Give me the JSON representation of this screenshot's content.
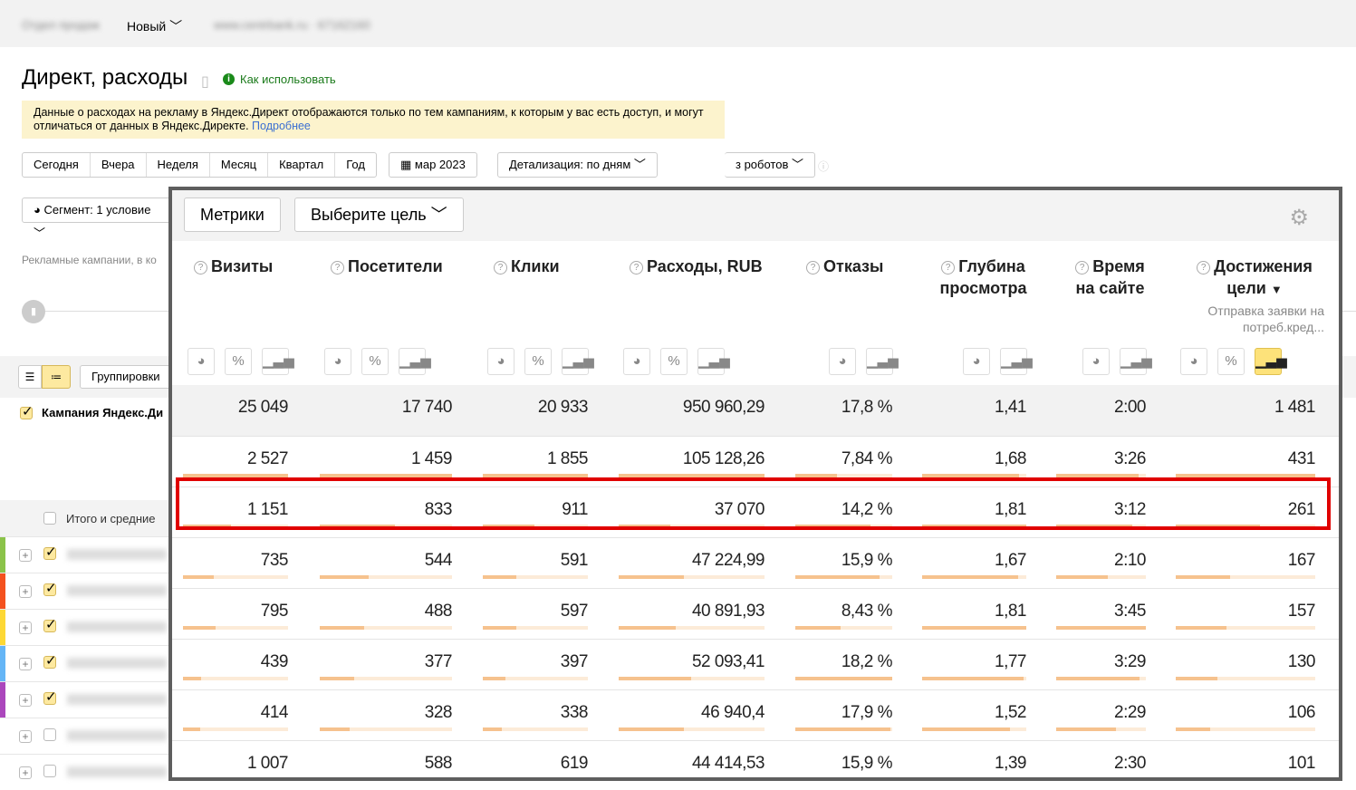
{
  "topbar": {
    "counter_name": "Отдел продаж",
    "counter_type": "Новый",
    "site": "www.centrbank.ru · 67162160"
  },
  "page": {
    "title": "Директ, расходы",
    "how_to": "Как использовать"
  },
  "notice": {
    "text": "Данные о расходах на рекламу в Яндекс.Директ отображаются только по тем кампаниям, к которым у вас есть доступ, и могут отличаться от данных в Яндекс.Директе.",
    "link": "Подробнее"
  },
  "periods": [
    "Сегодня",
    "Вчера",
    "Неделя",
    "Месяц",
    "Квартал",
    "Год"
  ],
  "date_range": "мар 2023",
  "detail": "Детализация: по дням",
  "robots": "з роботов",
  "segment": "Сегмент: 1 условие",
  "campaigns_label": "Рекламные кампании, в ко",
  "groupings": "Группировки",
  "grouping_root": "Кампания Яндекс.Ди",
  "totals_label": "Итого и средние",
  "left_rows": [
    {
      "color": "#8bc34a",
      "checked": true
    },
    {
      "color": "#f4511e",
      "checked": true
    },
    {
      "color": "#fdd835",
      "checked": true
    },
    {
      "color": "#64b5f6",
      "checked": true
    },
    {
      "color": "#ab47bc",
      "checked": true
    },
    {
      "color": "",
      "checked": false
    },
    {
      "color": "",
      "checked": false
    }
  ],
  "panel": {
    "metrics_button": "Метрики",
    "goal_button": "Выберите цель",
    "columns": [
      {
        "label": "Визиты",
        "icons": [
          "pie",
          "percent",
          "bars"
        ]
      },
      {
        "label": "Посетители",
        "icons": [
          "pie",
          "percent",
          "bars"
        ]
      },
      {
        "label": "Клики",
        "icons": [
          "pie",
          "percent",
          "bars"
        ]
      },
      {
        "label": "Расходы, RUB",
        "icons": [
          "pie",
          "percent",
          "bars"
        ]
      },
      {
        "label": "Отказы",
        "icons": [
          "pie",
          "bars"
        ]
      },
      {
        "label": "Глубина просмотра",
        "icons": [
          "pie",
          "bars"
        ]
      },
      {
        "label": "Время на сайте",
        "icons": [
          "pie",
          "bars"
        ]
      },
      {
        "label": "Достижения цели",
        "sort": "▼",
        "sub": "Отправка заявки на потреб.кред...",
        "icons": [
          "pie",
          "percent",
          "bars"
        ],
        "active_icon": "bars"
      }
    ],
    "totals": [
      "25 049",
      "17 740",
      "20 933",
      "950 960,29",
      "17,8 %",
      "1,41",
      "2:00",
      "1 481"
    ],
    "rows": [
      [
        "2 527",
        "1 459",
        "1 855",
        "105 128,26",
        "7,84 %",
        "1,68",
        "3:26",
        "431"
      ],
      [
        "1 151",
        "833",
        "911",
        "37 070",
        "14,2 %",
        "1,81",
        "3:12",
        "261"
      ],
      [
        "735",
        "544",
        "591",
        "47 224,99",
        "15,9 %",
        "1,67",
        "2:10",
        "167"
      ],
      [
        "795",
        "488",
        "597",
        "40 891,93",
        "8,43 %",
        "1,81",
        "3:45",
        "157"
      ],
      [
        "439",
        "377",
        "397",
        "52 093,41",
        "18,2 %",
        "1,77",
        "3:29",
        "130"
      ],
      [
        "414",
        "328",
        "338",
        "46 940,4",
        "17,9 %",
        "1,52",
        "2:29",
        "106"
      ],
      [
        "1 007",
        "588",
        "619",
        "44 414,53",
        "15,9 %",
        "1,39",
        "2:30",
        "101"
      ]
    ],
    "highlighted_row": 1,
    "highlight_color": "#e00000",
    "bar_color": "#f6c28e"
  }
}
